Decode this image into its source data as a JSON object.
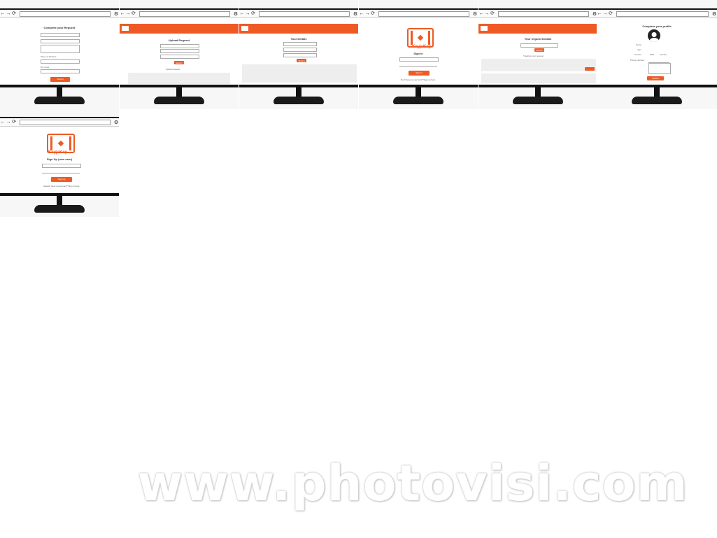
{
  "watermark": "www.photovisi.com",
  "colors": {
    "accent": "#ef5a24",
    "monitor": "#111111"
  },
  "icons": [
    "back-arrow-icon",
    "forward-arrow-icon",
    "refresh-icon",
    "gear-icon",
    "avatar-icon",
    "logo-icon"
  ],
  "screens": [
    {
      "id": "screen-1",
      "title": "Complete your Request",
      "labels": [
        "Place of Address",
        "Pin Code"
      ],
      "button": "Submit"
    },
    {
      "id": "screen-2",
      "title": "Upload Request",
      "button": "Submit",
      "link": "Upload request"
    },
    {
      "id": "screen-3",
      "title": "Your Details",
      "button": "Submit"
    },
    {
      "id": "screen-4",
      "brand": "KeyjaKey",
      "title": "Sign In",
      "button": "Sign In",
      "link": "Don't have an account? Sign up here"
    },
    {
      "id": "screen-5",
      "title": "Your request Details",
      "button": "Submit",
      "subtitle": "Tracking your request"
    },
    {
      "id": "screen-6",
      "title": "Complete your profile",
      "labels": [
        "Name",
        "Age",
        "Gender",
        "Phone Number"
      ],
      "options": [
        "Male",
        "Female"
      ],
      "button": "Submit"
    },
    {
      "id": "screen-7",
      "brand": "KeyjaKey",
      "title": "Sign Up (new user)",
      "button": "Sign Up",
      "link": "Already have an account? Sign in here"
    }
  ]
}
